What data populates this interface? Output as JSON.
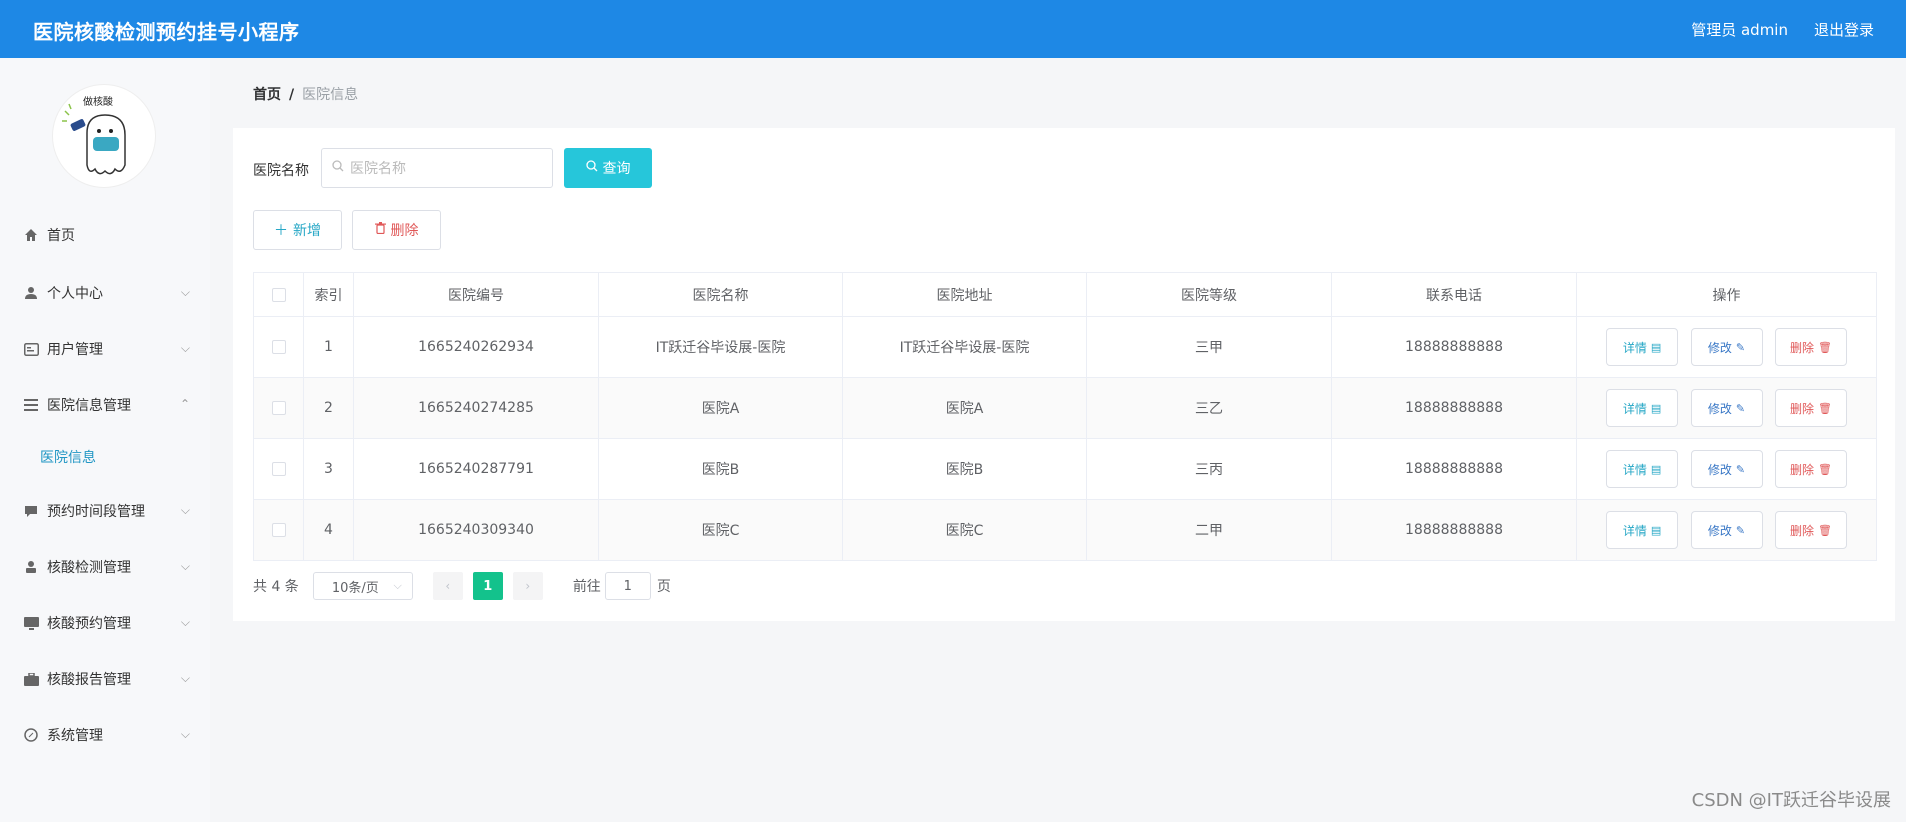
{
  "header": {
    "title": "医院核酸检测预约挂号小程序",
    "admin_label": "管理员 admin",
    "logout_label": "退出登录"
  },
  "sidebar": {
    "items": [
      {
        "label": "首页",
        "icon": "home-icon"
      },
      {
        "label": "个人中心",
        "icon": "user-icon"
      },
      {
        "label": "用户管理",
        "icon": "id-card-icon"
      },
      {
        "label": "医院信息管理",
        "icon": "menu-lines-icon"
      },
      {
        "label": "预约时间段管理",
        "icon": "chat-icon"
      },
      {
        "label": "核酸检测管理",
        "icon": "person-icon"
      },
      {
        "label": "核酸预约管理",
        "icon": "monitor-icon"
      },
      {
        "label": "核酸报告管理",
        "icon": "briefcase-icon"
      },
      {
        "label": "系统管理",
        "icon": "compass-icon"
      }
    ],
    "sub_item": "医院信息"
  },
  "breadcrumb": {
    "home": "首页",
    "separator": "/",
    "current": "医院信息"
  },
  "search": {
    "label": "医院名称",
    "placeholder": "医院名称",
    "query_label": "查询"
  },
  "actions": {
    "add_label": "新增",
    "delete_label": "删除"
  },
  "table": {
    "columns": [
      "索引",
      "医院编号",
      "医院名称",
      "医院地址",
      "医院等级",
      "联系电话",
      "操作"
    ],
    "rows": [
      {
        "index": "1",
        "code": "1665240262934",
        "name": "IT跃迁谷毕设展-医院",
        "address": "IT跃迁谷毕设展-医院",
        "level": "三甲",
        "phone": "18888888888"
      },
      {
        "index": "2",
        "code": "1665240274285",
        "name": "医院A",
        "address": "医院A",
        "level": "三乙",
        "phone": "18888888888"
      },
      {
        "index": "3",
        "code": "1665240287791",
        "name": "医院B",
        "address": "医院B",
        "level": "三丙",
        "phone": "18888888888"
      },
      {
        "index": "4",
        "code": "1665240309340",
        "name": "医院C",
        "address": "医院C",
        "level": "二甲",
        "phone": "18888888888"
      }
    ],
    "op_labels": {
      "detail": "详情",
      "edit": "修改",
      "delete": "删除"
    }
  },
  "pagination": {
    "total": "共 4 条",
    "page_size": "10条/页",
    "current_page": "1",
    "goto_label": "前往",
    "goto_value": "1",
    "goto_suffix": "页"
  },
  "watermark": "CSDN @IT跃迁谷毕设展",
  "colors": {
    "header_bg": "#1e88e5",
    "query_btn": "#26c6da",
    "active_page": "#13c28c",
    "delete_red": "#e05858"
  }
}
